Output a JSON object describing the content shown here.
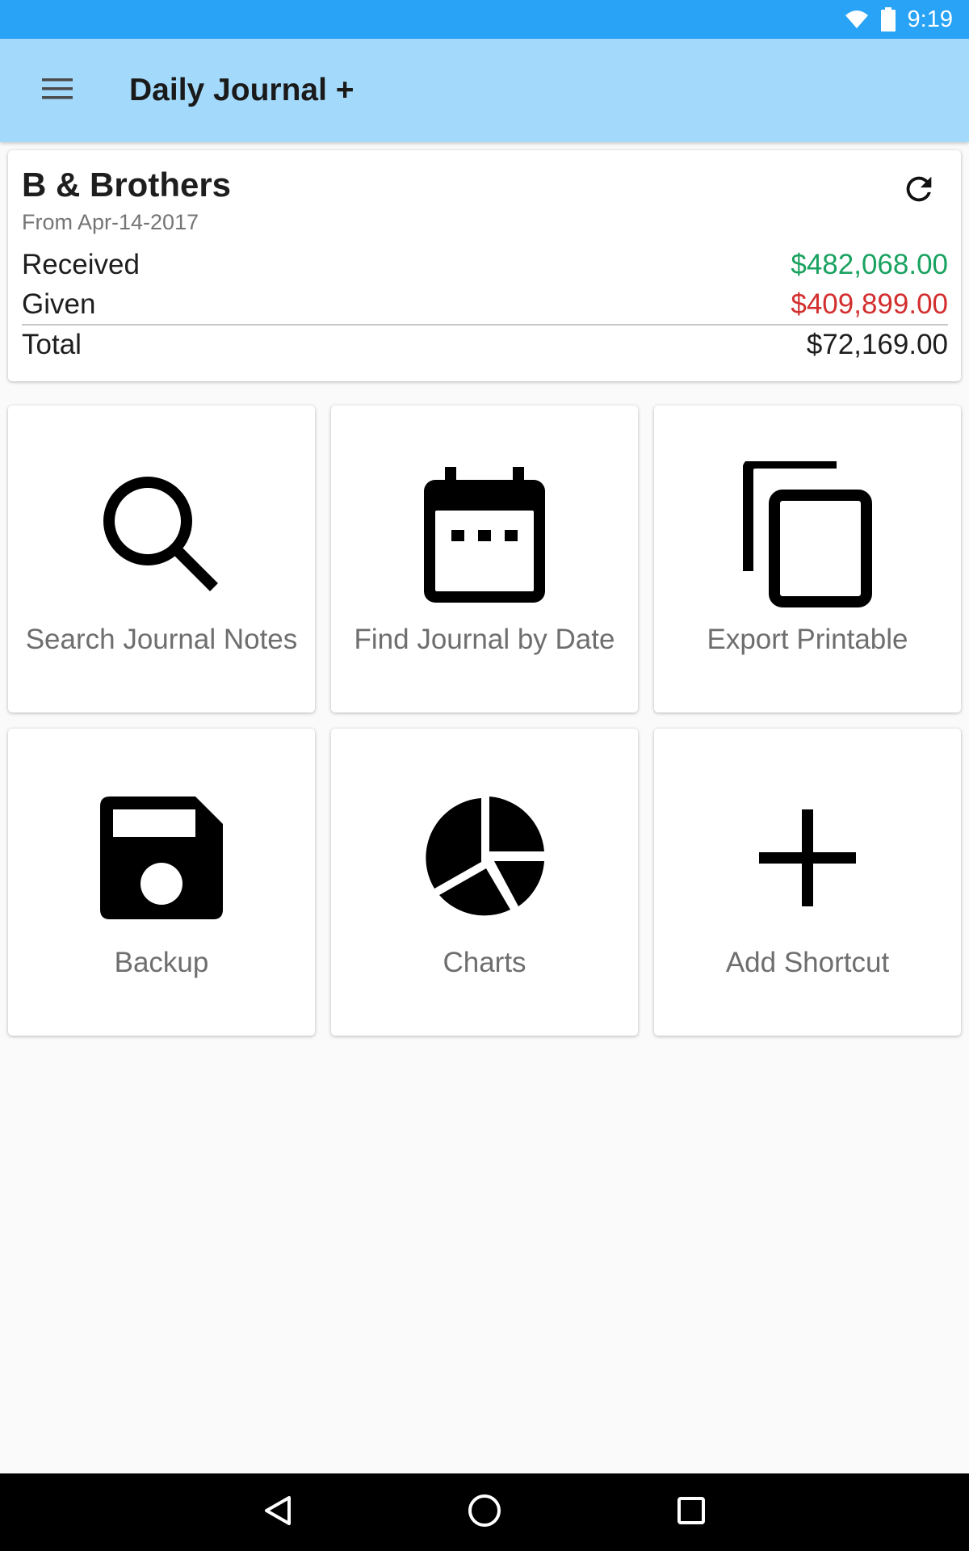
{
  "status_bar": {
    "time": "9:19",
    "icons": [
      "wifi-icon",
      "battery-icon"
    ],
    "color": "#29a3f5"
  },
  "app_bar": {
    "title": "Daily Journal +",
    "menu_icon": "hamburger-menu-icon",
    "color": "#a3dafb"
  },
  "summary": {
    "name": "B & Brothers",
    "from": "From Apr-14-2017",
    "refresh_icon": "refresh-icon",
    "rows": [
      {
        "label": "Received",
        "value": "$482,068.00",
        "color": "#1aa260"
      },
      {
        "label": "Given",
        "value": "$409,899.00",
        "color": "#d32f2f"
      },
      {
        "label": "Total",
        "value": "$72,169.00",
        "color": "#1e1e1e"
      }
    ]
  },
  "tiles": [
    {
      "label": "Search Journal Notes",
      "icon": "search-icon"
    },
    {
      "label": "Find Journal by Date",
      "icon": "calendar-icon"
    },
    {
      "label": "Export Printable",
      "icon": "copy-icon"
    },
    {
      "label": "Backup",
      "icon": "save-icon"
    },
    {
      "label": "Charts",
      "icon": "pie-chart-icon"
    },
    {
      "label": "Add Shortcut",
      "icon": "plus-icon"
    }
  ],
  "nav_bar": {
    "icons": [
      "back-icon",
      "home-icon",
      "recents-icon"
    ]
  }
}
